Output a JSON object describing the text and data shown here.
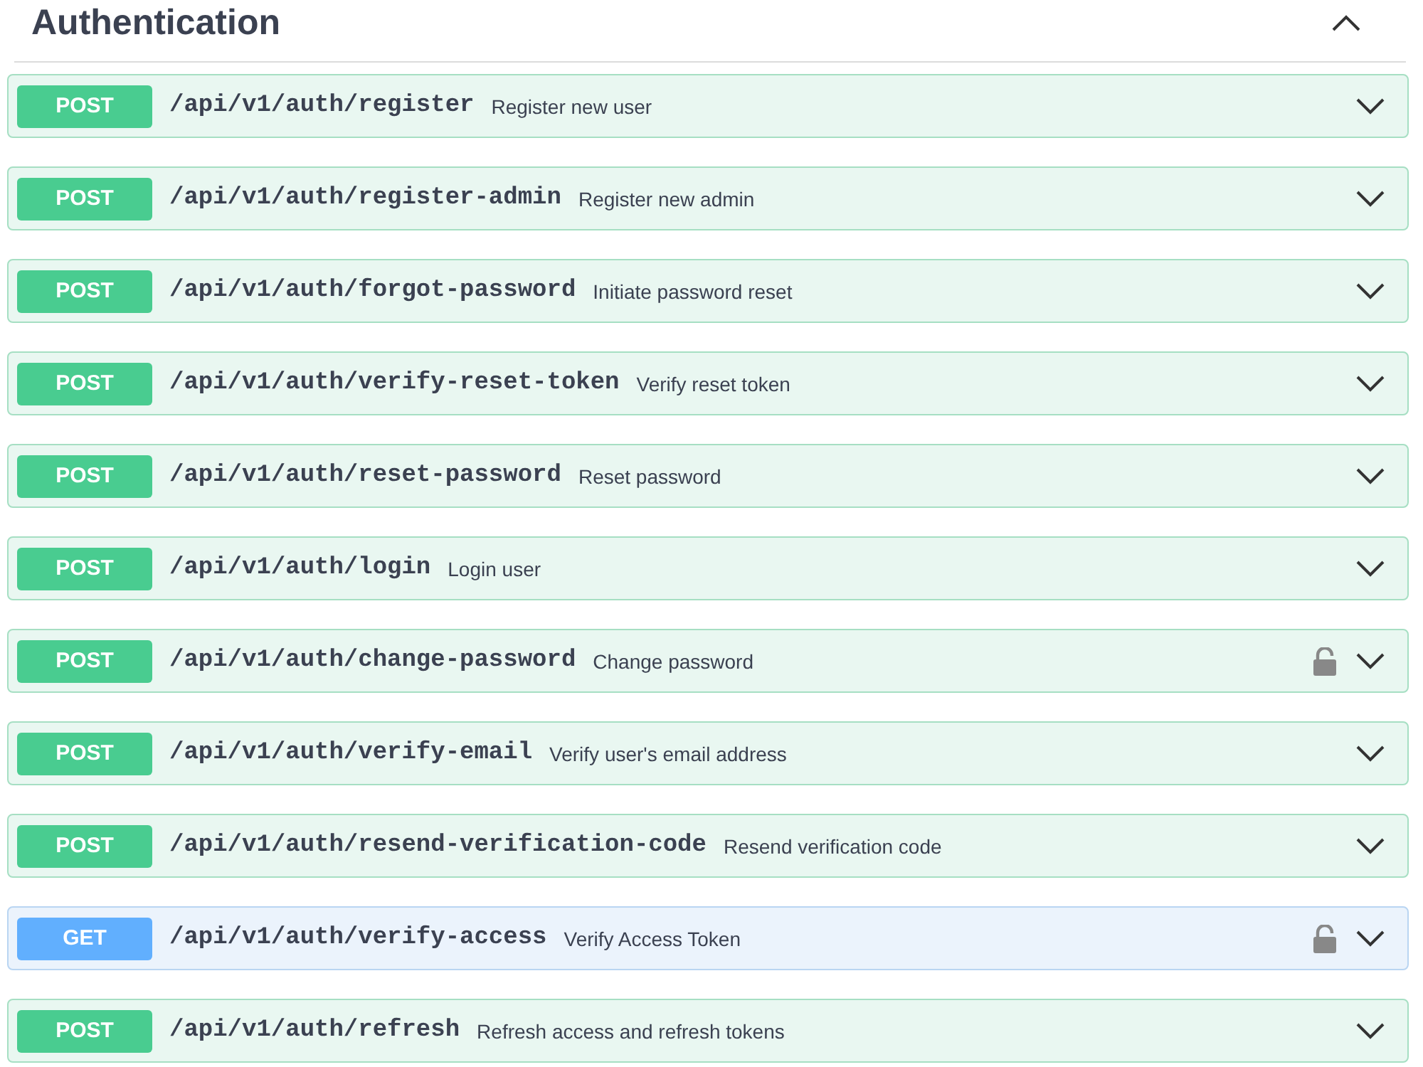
{
  "section": {
    "title": "Authentication",
    "expanded": true
  },
  "operations": [
    {
      "kind": "post",
      "method": "POST",
      "path": "/api/v1/auth/register",
      "summary": "Register new user",
      "locked": false,
      "expanded": false
    },
    {
      "kind": "post",
      "method": "POST",
      "path": "/api/v1/auth/register-admin",
      "summary": "Register new admin",
      "locked": false,
      "expanded": false
    },
    {
      "kind": "post",
      "method": "POST",
      "path": "/api/v1/auth/forgot-password",
      "summary": "Initiate password reset",
      "locked": false,
      "expanded": false
    },
    {
      "kind": "post",
      "method": "POST",
      "path": "/api/v1/auth/verify-reset-token",
      "summary": "Verify reset token",
      "locked": false,
      "expanded": false
    },
    {
      "kind": "post",
      "method": "POST",
      "path": "/api/v1/auth/reset-password",
      "summary": "Reset password",
      "locked": false,
      "expanded": false
    },
    {
      "kind": "post",
      "method": "POST",
      "path": "/api/v1/auth/login",
      "summary": "Login user",
      "locked": false,
      "expanded": false
    },
    {
      "kind": "post",
      "method": "POST",
      "path": "/api/v1/auth/change-password",
      "summary": "Change password",
      "locked": true,
      "expanded": false
    },
    {
      "kind": "post",
      "method": "POST",
      "path": "/api/v1/auth/verify-email",
      "summary": "Verify user's email address",
      "locked": false,
      "expanded": false
    },
    {
      "kind": "post",
      "method": "POST",
      "path": "/api/v1/auth/resend-verification-code",
      "summary": "Resend verification code",
      "locked": false,
      "expanded": false
    },
    {
      "kind": "get",
      "method": "GET",
      "path": "/api/v1/auth/verify-access",
      "summary": "Verify Access Token",
      "locked": true,
      "expanded": false
    },
    {
      "kind": "post",
      "method": "POST",
      "path": "/api/v1/auth/refresh",
      "summary": "Refresh access and refresh tokens",
      "locked": false,
      "expanded": false
    }
  ]
}
